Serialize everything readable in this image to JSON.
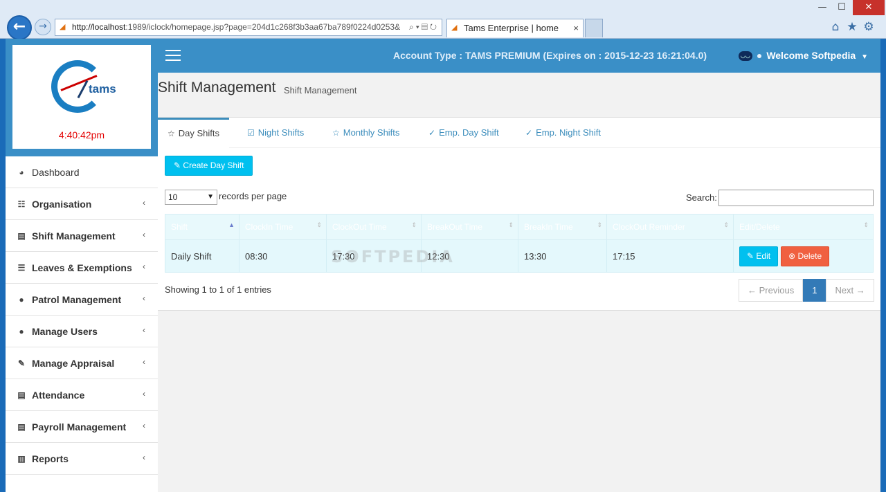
{
  "browser": {
    "url_host": "http://localhost",
    "url_rest": ":1989/iclock/homepage.jsp?page=204d1c268f3b3aa67ba789f0224d0253&",
    "tab_title": "Tams Enterprise | home",
    "tab_close": "×",
    "minimize": "—",
    "maximize": "☐",
    "close": "✕"
  },
  "sidebar": {
    "logo_text": "tams",
    "clock": "4:40:42pm",
    "items": [
      {
        "label": "Dashboard",
        "icon": "dashboard-icon"
      },
      {
        "label": "Organisation",
        "icon": "sitemap-icon"
      },
      {
        "label": "Shift Management",
        "icon": "list-icon"
      },
      {
        "label": "Leaves & Exemptions",
        "icon": "bars-icon"
      },
      {
        "label": "Patrol Management",
        "icon": "user-icon"
      },
      {
        "label": "Manage Users",
        "icon": "user-icon"
      },
      {
        "label": "Manage Appraisal",
        "icon": "edit-icon"
      },
      {
        "label": "Attendance",
        "icon": "list-icon"
      },
      {
        "label": "Payroll Management",
        "icon": "list-icon"
      },
      {
        "label": "Reports",
        "icon": "bar-chart-icon"
      }
    ]
  },
  "topbar": {
    "account": "Account Type : TAMS PREMIUM (Expires on : 2015-12-23 16:21:04.0)",
    "welcome": "Welcome Softpedia"
  },
  "page": {
    "title": "Shift Management",
    "subtitle": "Shift Management"
  },
  "tabs": [
    {
      "label": "Day Shifts",
      "active": true
    },
    {
      "label": "Night Shifts",
      "active": false
    },
    {
      "label": "Monthly Shifts",
      "active": false
    },
    {
      "label": "Emp. Day Shift",
      "active": false
    },
    {
      "label": "Emp. Night Shift",
      "active": false
    }
  ],
  "toolbar": {
    "create_label": "Create Day Shift",
    "records_value": "10",
    "records_label": "records per page",
    "search_label": "Search:"
  },
  "table": {
    "headers": [
      "Shift",
      "ClockIn Time",
      "ClockOut Time",
      "BreakOut Time",
      "BreakIn Time",
      "ClockOut Reminder",
      "Edit/Delete"
    ],
    "rows": [
      {
        "shift": "Daily Shift",
        "clockin": "08:30",
        "clockout": "17:30",
        "breakout": "12:30",
        "breakin": "13:30",
        "reminder": "17:15"
      }
    ],
    "edit_label": "Edit",
    "delete_label": "Delete"
  },
  "footer": {
    "info": "Showing 1 to 1 of 1 entries",
    "previous": "← Previous",
    "page": "1",
    "next": "Next →"
  },
  "watermark": "SOFTPEDIA",
  "colors": {
    "topbar": "#3a8fc7",
    "accent": "#3c8dbc",
    "info_button": "#00c0ef",
    "danger_button": "#f06040",
    "pager_active": "#337ab7",
    "clock_text": "#e30000"
  }
}
